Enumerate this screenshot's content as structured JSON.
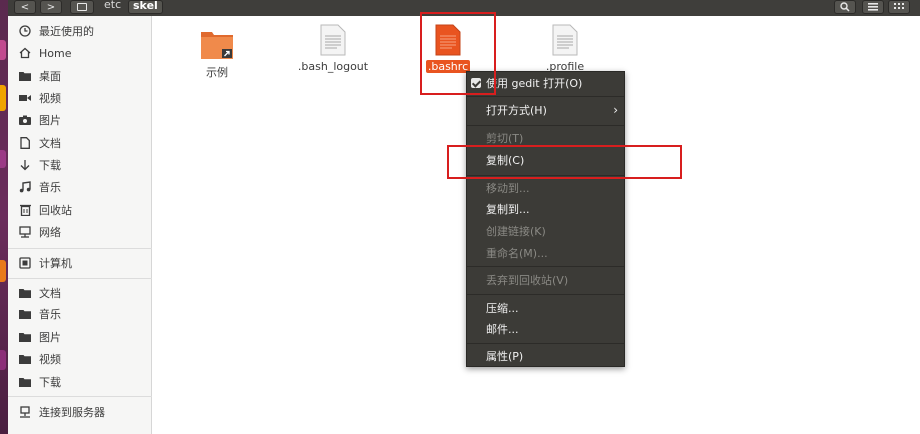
{
  "toolbar": {
    "back": "<",
    "forward": ">",
    "path": [
      {
        "label": "etc",
        "active": false
      },
      {
        "label": "skel",
        "active": true
      }
    ]
  },
  "sidebar": {
    "items": [
      {
        "label": "最近使用的",
        "icon": "clock-icon"
      },
      {
        "label": "Home",
        "icon": "home-icon"
      },
      {
        "label": "桌面",
        "icon": "folder-icon"
      },
      {
        "label": "视频",
        "icon": "video-icon"
      },
      {
        "label": "图片",
        "icon": "camera-icon"
      },
      {
        "label": "文档",
        "icon": "document-icon"
      },
      {
        "label": "下载",
        "icon": "download-icon"
      },
      {
        "label": "音乐",
        "icon": "music-icon"
      },
      {
        "label": "回收站",
        "icon": "trash-icon"
      },
      {
        "label": "网络",
        "icon": "network-icon"
      },
      {
        "label": "计算机",
        "icon": "computer-icon"
      },
      {
        "label": "文档",
        "icon": "folder-icon"
      },
      {
        "label": "音乐",
        "icon": "folder-icon"
      },
      {
        "label": "图片",
        "icon": "folder-icon"
      },
      {
        "label": "视频",
        "icon": "folder-icon"
      },
      {
        "label": "下载",
        "icon": "folder-icon"
      },
      {
        "label": "连接到服务器",
        "icon": "server-icon"
      }
    ]
  },
  "files": [
    {
      "name": "示例",
      "type": "folder-link"
    },
    {
      "name": ".bash_logout",
      "type": "text"
    },
    {
      "name": ".bashrc",
      "type": "text",
      "selected": true
    },
    {
      "name": ".profile",
      "type": "text"
    }
  ],
  "context_menu": {
    "items": [
      {
        "label": "使用 gedit 打开(O)",
        "enabled": true,
        "checked": true
      },
      {
        "label": "打开方式(H)",
        "enabled": true,
        "submenu": true
      },
      {
        "label": "剪切(T)",
        "enabled": false
      },
      {
        "label": "复制(C)",
        "enabled": true
      },
      {
        "label": "移动到...",
        "enabled": false
      },
      {
        "label": "复制到...",
        "enabled": true
      },
      {
        "label": "创建链接(K)",
        "enabled": false
      },
      {
        "label": "重命名(M)...",
        "enabled": false
      },
      {
        "label": "丢弃到回收站(V)",
        "enabled": false
      },
      {
        "label": "压缩...",
        "enabled": true
      },
      {
        "label": "邮件...",
        "enabled": true
      },
      {
        "label": "属性(P)",
        "enabled": true
      }
    ]
  },
  "colors": {
    "accent": "#e95420",
    "annotation": "#d81e1e",
    "menu_bg": "#3c3b37",
    "headerbar": "#3f3e3b"
  }
}
